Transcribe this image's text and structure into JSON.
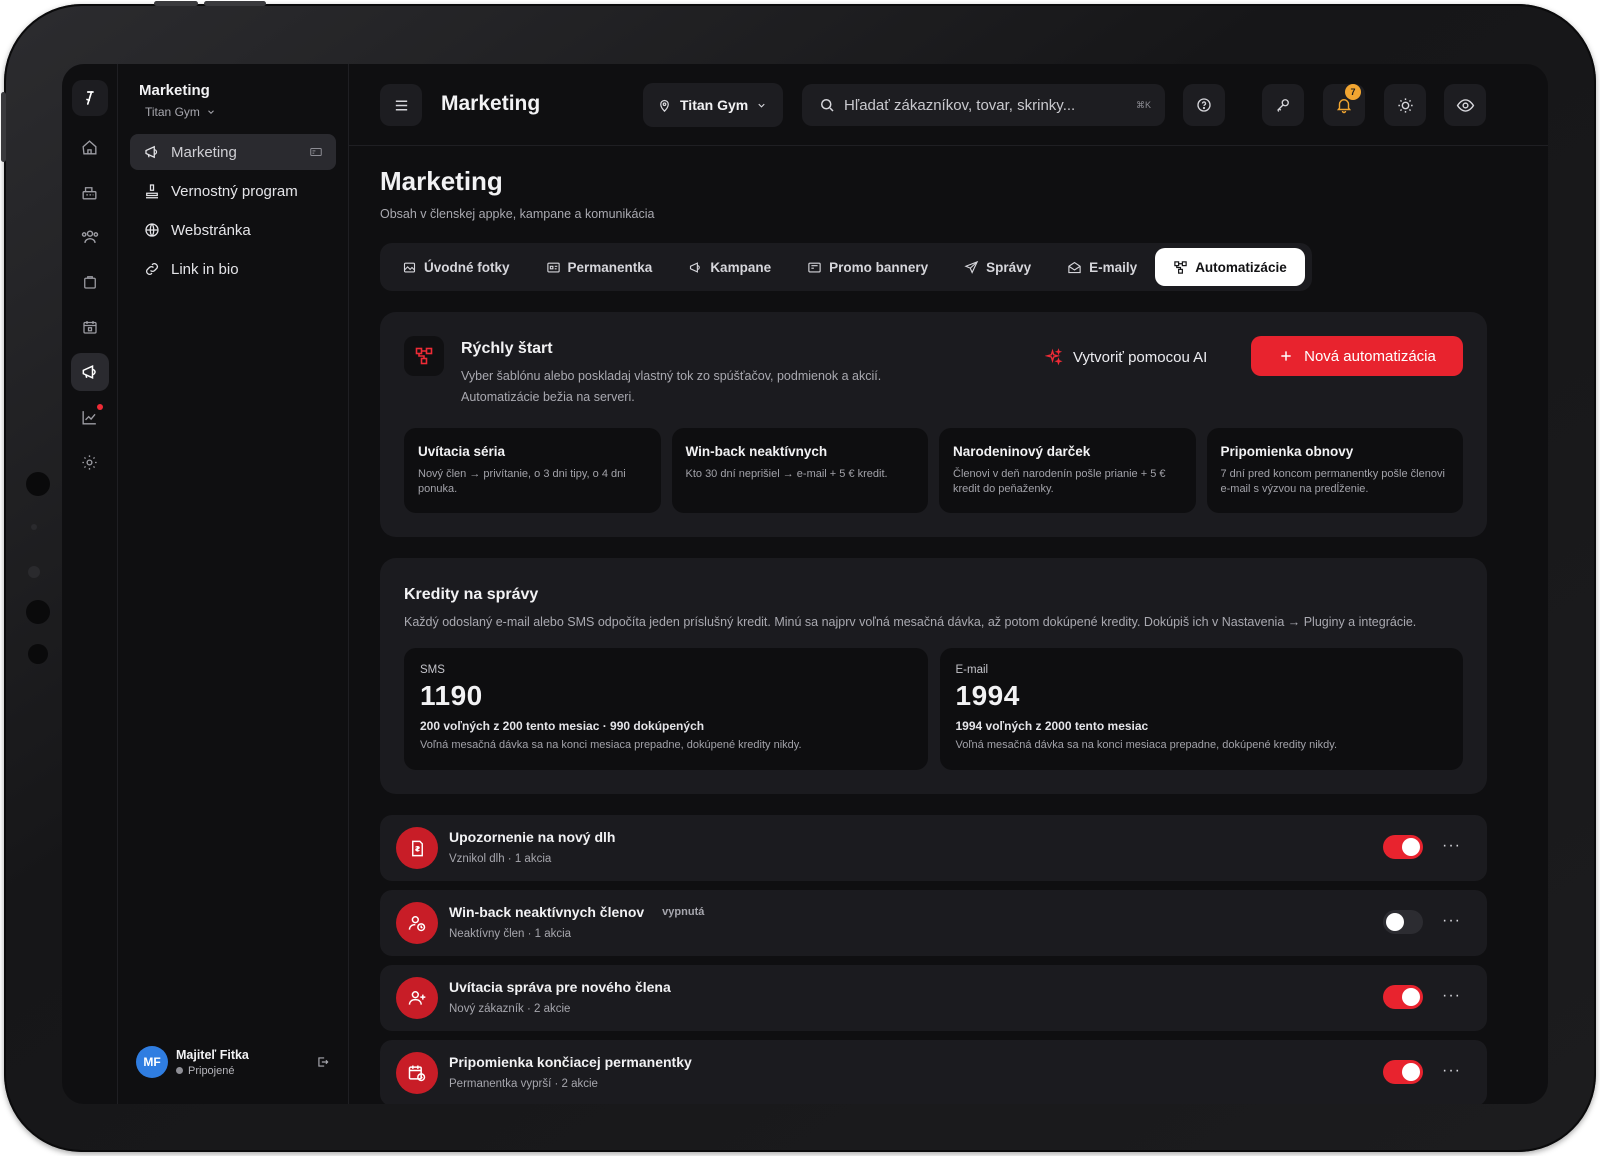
{
  "sidebar": {
    "title": "Marketing",
    "gym": "Titan Gym",
    "items": [
      {
        "label": "Marketing"
      },
      {
        "label": "Vernostný program"
      },
      {
        "label": "Webstránka"
      },
      {
        "label": "Link in bio"
      }
    ],
    "user": {
      "initials": "MF",
      "name": "Majiteľ Fitka",
      "status": "Pripojené"
    }
  },
  "header": {
    "title": "Marketing",
    "location": "Titan Gym",
    "search_placeholder": "Hľadať zákazníkov, tovar, skrinky...",
    "search_shortcut": "⌘K",
    "notification_count": "7"
  },
  "page": {
    "title": "Marketing",
    "subtitle": "Obsah v členskej appke, kampane a komunikácia"
  },
  "tabs": [
    {
      "label": "Úvodné fotky"
    },
    {
      "label": "Permanentka"
    },
    {
      "label": "Kampane"
    },
    {
      "label": "Promo bannery"
    },
    {
      "label": "Správy"
    },
    {
      "label": "E-maily"
    },
    {
      "label": "Automatizácie"
    }
  ],
  "quick_start": {
    "title": "Rýchly štart",
    "desc_line1": "Vyber šablónu alebo poskladaj vlastný tok zo spúšťačov, podmienok a akcií.",
    "desc_line2": "Automatizácie bežia na serveri.",
    "ai_label": "Vytvoriť pomocou AI",
    "new_label": "Nová automatizácia",
    "templates": [
      {
        "title": "Uvítacia séria",
        "desc": "Nový člen → privítanie, o 3 dni tipy, o 4 dni ponuka."
      },
      {
        "title": "Win-back neaktívnych",
        "desc": "Kto 30 dní neprišiel → e-mail + 5 € kredit."
      },
      {
        "title": "Narodeninový darček",
        "desc": "Členovi v deň narodenín pošle prianie + 5 € kredit do peňaženky."
      },
      {
        "title": "Pripomienka obnovy",
        "desc": "7 dní pred koncom permanentky pošle členovi e-mail s výzvou na predĺženie."
      }
    ]
  },
  "credits": {
    "title": "Kredity na správy",
    "desc": "Každý odoslaný e-mail alebo SMS odpočíta jeden príslušný kredit. Minú sa najprv voľná mesačná dávka, až potom dokúpené kredity. Dokúpiš ich v Nastavenia → Pluginy a integrácie.",
    "sms": {
      "label": "SMS",
      "value": "1190",
      "detail": "200 voľných z 200 tento mesiac · 990 dokúpených",
      "note": "Voľná mesačná dávka sa na konci mesiaca prepadne, dokúpené kredity nikdy."
    },
    "email": {
      "label": "E-mail",
      "value": "1994",
      "detail": "1994 voľných z 2000 tento mesiac",
      "note": "Voľná mesačná dávka sa na konci mesiaca prepadne, dokúpené kredity nikdy."
    }
  },
  "automations": [
    {
      "title": "Upozornenie na nový dlh",
      "sub": "Vznikol dlh · 1 akcia",
      "badge": "",
      "enabled": true,
      "icon": "invoice-icon"
    },
    {
      "title": "Win-back neaktívnych členov",
      "sub": "Neaktívny člen · 1 akcia",
      "badge": "vypnutá",
      "enabled": false,
      "icon": "user-clock-icon"
    },
    {
      "title": "Uvítacia správa pre nového člena",
      "sub": "Nový zákazník · 2 akcie",
      "badge": "",
      "enabled": true,
      "icon": "user-plus-icon"
    },
    {
      "title": "Pripomienka končiacej permanentky",
      "sub": "Permanentka vyprší · 2 akcie",
      "badge": "",
      "enabled": true,
      "icon": "calendar-clock-icon"
    }
  ],
  "colors": {
    "accent": "#e8232e",
    "background": "#0f0f11",
    "card": "#1b1b1f"
  }
}
